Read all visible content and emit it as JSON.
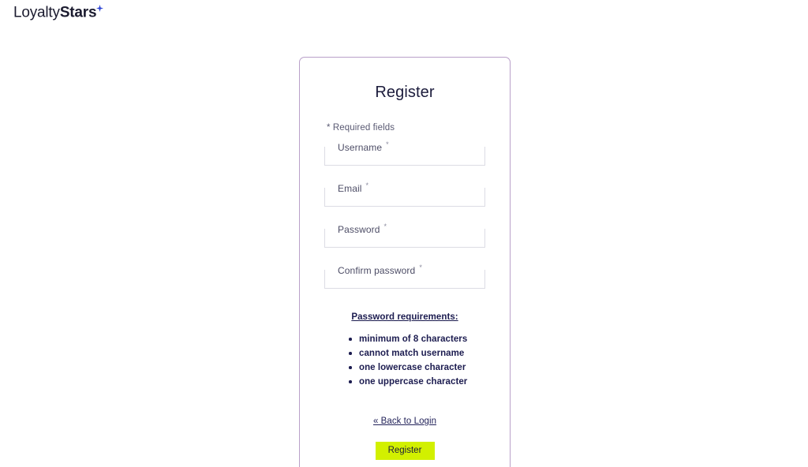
{
  "brand": {
    "name_light": "Loyalty",
    "name_bold": "Stars",
    "star_icon": "sparkle-icon",
    "star_color": "#2b43d4",
    "text_color": "#1b1b2f"
  },
  "card": {
    "title": "Register",
    "required_note": "* Required fields",
    "border_color": "#b9a0c9"
  },
  "form": {
    "fields": [
      {
        "name": "username",
        "label": "Username",
        "required_mark": "*",
        "value": "",
        "placeholder": ""
      },
      {
        "name": "email",
        "label": "Email",
        "required_mark": "*",
        "value": "",
        "placeholder": ""
      },
      {
        "name": "password",
        "label": "Password",
        "required_mark": "*",
        "value": "",
        "placeholder": ""
      },
      {
        "name": "confirm_password",
        "label": "Confirm password",
        "required_mark": "*",
        "value": "",
        "placeholder": ""
      }
    ]
  },
  "password_requirements": {
    "title": "Password requirements:",
    "items": [
      "minimum of 8 characters",
      "cannot match username",
      "one lowercase character",
      "one uppercase character"
    ]
  },
  "actions": {
    "back_link": "« Back to Login",
    "submit_label": "Register",
    "submit_color": "#d2f000",
    "submit_text_color": "#1c1c3c"
  }
}
